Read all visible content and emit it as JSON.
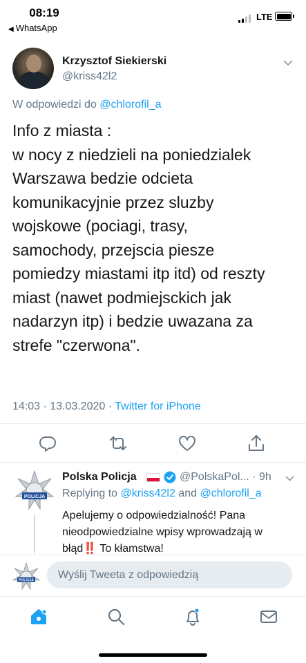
{
  "status_bar": {
    "time": "08:19",
    "back_app": "WhatsApp",
    "network": "LTE",
    "signal_bars": 2,
    "battery_level": 1.0
  },
  "tweet": {
    "author_name": "Krzysztof Siekierski",
    "author_handle": "@kriss42l2",
    "reply_prefix": "W odpowiedzi do",
    "reply_to": "@chlorofil_a",
    "text_lines": [
      "Info z miasta :",
      "w nocy z niedzieli na poniedzialek",
      "Warszawa bedzie odcieta",
      "komunikacyjnie przez sluzby",
      "wojskowe (pociagi, trasy,",
      "samochody, przejscia piesze",
      "pomiedzy miastami itp itd) od reszty",
      "miast (nawet podmiejsckich jak",
      "nadarzyn itp) i bedzie uwazana za",
      "strefe \"czerwona\"."
    ],
    "timestamp": "14:03 · 13.03.2020 ·",
    "source": "Twitter for iPhone",
    "actions": [
      {
        "name": "reply-icon"
      },
      {
        "name": "retweet-icon"
      },
      {
        "name": "like-icon"
      },
      {
        "name": "share-icon"
      }
    ]
  },
  "reply": {
    "author_name": "Polska Policja",
    "author_handle": "@PolskaPol... · 9h",
    "avatar_badge_text": "POLICJA",
    "replying_prefix": "Replying to",
    "replying_user1": "@kriss42l2",
    "replying_and": "and",
    "replying_user2": "@chlorofil_a",
    "text_line1": "Apelujemy o odpowiedzialność! Pana",
    "text_line2": "nieodpowiedzialne wpisy wprowadzają w",
    "text_line3_a": "błąd",
    "text_line3_emoji": "‼️",
    "text_line3_b": " To kłamstwa!"
  },
  "compose": {
    "placeholder": "Wyślij Tweeta z odpowiedzią",
    "avatar_badge_text": "POLICJA"
  },
  "tabbar": {
    "tabs": [
      {
        "name": "home-icon",
        "active": true
      },
      {
        "name": "search-icon",
        "active": false
      },
      {
        "name": "notifications-icon",
        "active": false
      },
      {
        "name": "messages-icon",
        "active": false
      }
    ]
  },
  "colors": {
    "accent": "#1da1f2",
    "secondary_text": "#657786",
    "primary_text": "#14171a",
    "divider": "#e6ecf0"
  }
}
